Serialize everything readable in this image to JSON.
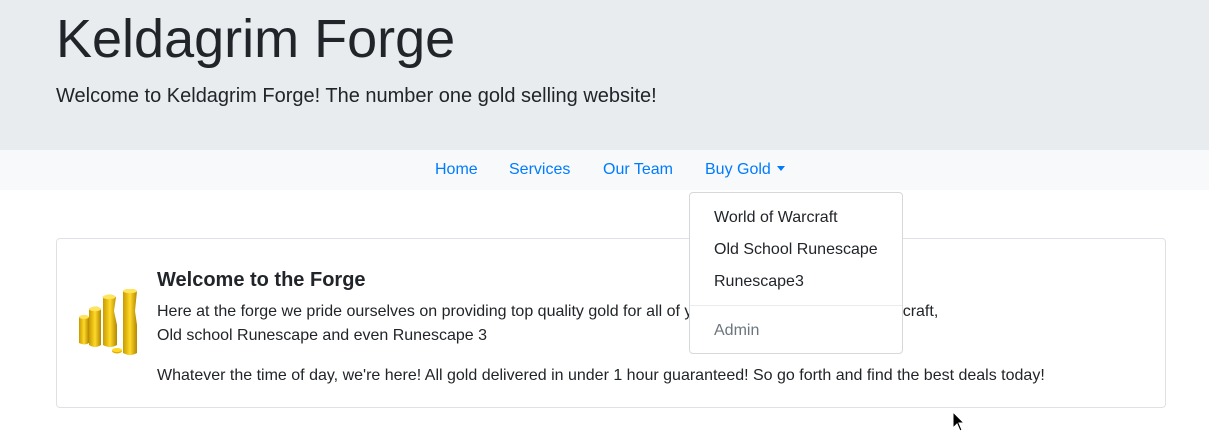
{
  "header": {
    "title": "Keldagrim Forge",
    "tagline": "Welcome to Keldagrim Forge! The number one gold selling website!"
  },
  "nav": {
    "items": [
      "Home",
      "Services",
      "Our Team",
      "Buy Gold"
    ]
  },
  "dropdown": {
    "items": [
      "World of Warcraft",
      "Old School Runescape",
      "Runescape3"
    ],
    "admin": "Admin"
  },
  "card": {
    "title": "Welcome to the Forge",
    "paragraph1_visible_left": "Here at the forge we pride ourselves on providing top quality gold for all of y",
    "paragraph1_visible_right": "is ranges from World of Warcraft,",
    "paragraph1_line2": "Old school Runescape and even Runescape 3",
    "paragraph2": "Whatever the time of day, we're here! All gold delivered in under 1 hour guaranteed! So go forth and find the best deals today!",
    "image": "gold-coin-stack-icon"
  },
  "colors": {
    "link": "#007bff",
    "jumbotron": "#e9ecef",
    "navbar": "#f8f9fa",
    "gold": "#f2c200"
  }
}
